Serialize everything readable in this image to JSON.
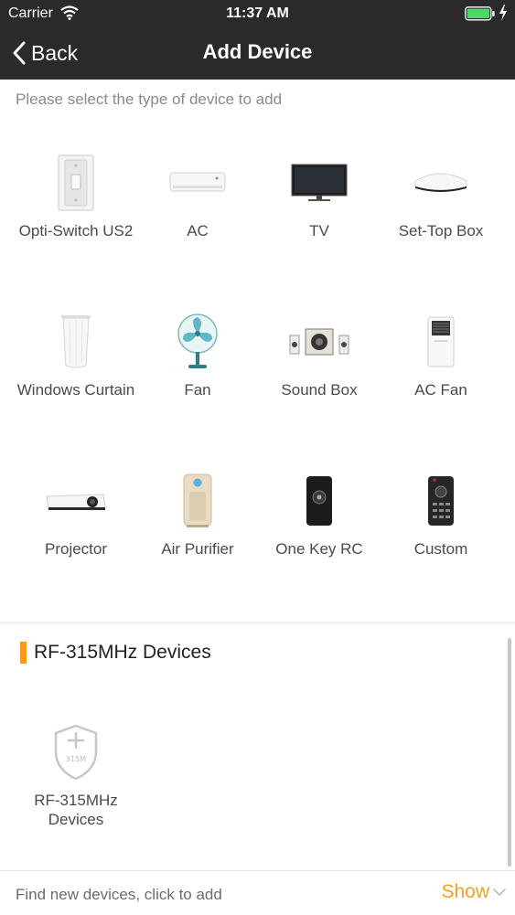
{
  "status_bar": {
    "carrier": "Carrier",
    "time": "11:37 AM"
  },
  "nav": {
    "back_label": "Back",
    "title": "Add Device"
  },
  "prompt": "Please select the type of device to add",
  "devices": [
    {
      "label": "Opti-Switch US2",
      "icon": "wall-switch-icon"
    },
    {
      "label": "AC",
      "icon": "air-conditioner-icon"
    },
    {
      "label": "TV",
      "icon": "tv-icon"
    },
    {
      "label": "Set-Top Box",
      "icon": "set-top-box-icon"
    },
    {
      "label": "Windows Curtain",
      "icon": "curtain-icon"
    },
    {
      "label": "Fan",
      "icon": "fan-icon"
    },
    {
      "label": "Sound Box",
      "icon": "sound-box-icon"
    },
    {
      "label": "AC Fan",
      "icon": "ac-fan-icon"
    },
    {
      "label": "Projector",
      "icon": "projector-icon"
    },
    {
      "label": "Air Purifier",
      "icon": "air-purifier-icon"
    },
    {
      "label": "One Key RC",
      "icon": "one-key-remote-icon"
    },
    {
      "label": "Custom",
      "icon": "custom-remote-icon"
    }
  ],
  "rf_section": {
    "title": "RF-315MHz Devices",
    "tile_label": "RF-315MHz Devices",
    "shield_text": "315M"
  },
  "footer": {
    "text": "Find new devices, click to add",
    "show_label": "Show"
  },
  "colors": {
    "nav_bg": "#2a2a2c",
    "accent": "#f89a1e",
    "show_text": "#f3a21b",
    "battery": "#4cd964"
  }
}
